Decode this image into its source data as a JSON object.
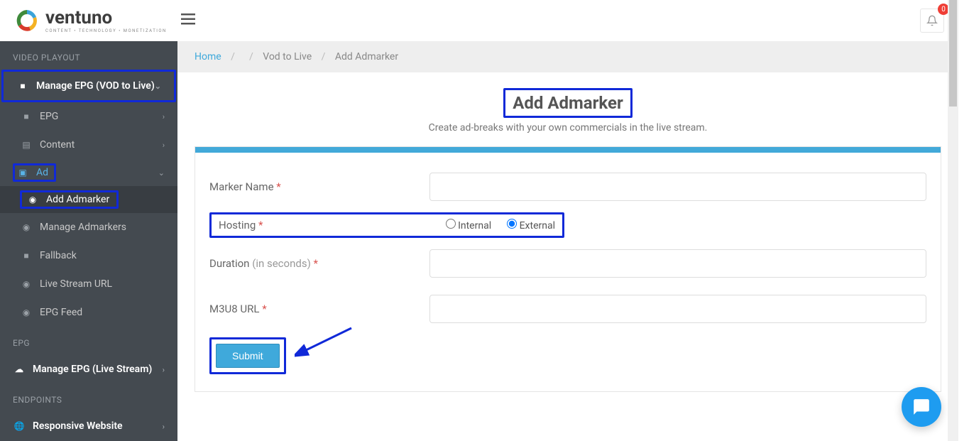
{
  "brand": {
    "name": "ventuno",
    "tagline": "CONTENT • TECHNOLOGY • MONETIZATION"
  },
  "notifications": {
    "count": "0"
  },
  "sidebar": {
    "section1": "VIDEO PLAYOUT",
    "manage_epg_vod": "Manage EPG (VOD to Live)",
    "epg": "EPG",
    "content": "Content",
    "ad": "Ad",
    "add_admarker": "Add Admarker",
    "manage_admarkers": "Manage Admarkers",
    "fallback": "Fallback",
    "live_stream_url": "Live Stream URL",
    "epg_feed": "EPG Feed",
    "section2": "EPG",
    "manage_epg_live": "Manage EPG (Live Stream)",
    "section3": "ENDPOINTS",
    "responsive_website": "Responsive Website"
  },
  "breadcrumb": {
    "home": "Home",
    "vod_to_live": "Vod to Live",
    "add_admarker": "Add Admarker"
  },
  "page": {
    "title": "Add Admarker",
    "subtitle": "Create ad-breaks with your own commercials in the live stream."
  },
  "form": {
    "marker_name_label": "Marker Name",
    "hosting_label": "Hosting",
    "hosting_internal": "Internal",
    "hosting_external": "External",
    "hosting_selected": "external",
    "duration_label": "Duration",
    "duration_hint": "(in seconds)",
    "m3u8_label": "M3U8 URL",
    "submit": "Submit"
  }
}
